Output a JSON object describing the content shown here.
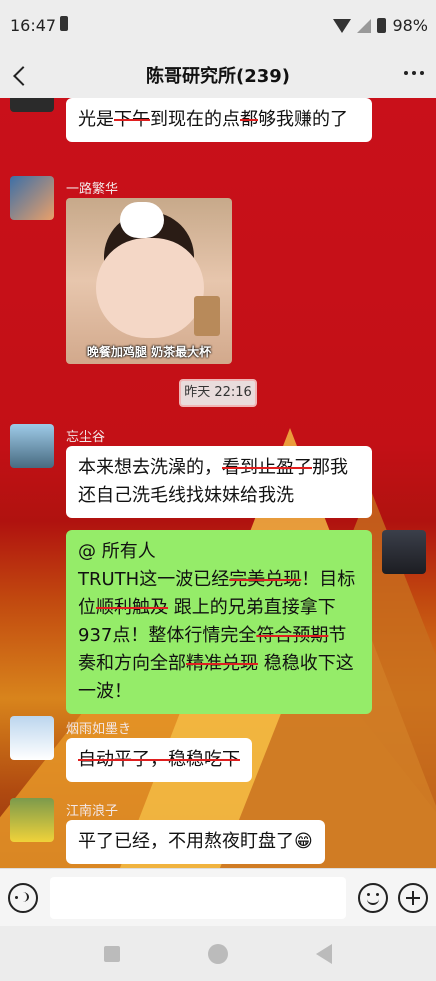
{
  "status_bar": {
    "time": "16:47",
    "battery": "98%"
  },
  "header": {
    "title": "陈哥研究所(239)"
  },
  "messages": {
    "m0": {
      "parts": [
        "光是",
        "下午",
        "到现在的点",
        "都",
        "够我赚的了"
      ]
    },
    "m1": {
      "sender": "一路繁华",
      "image_caption": "晚餐加鸡腿  奶茶最大杯"
    },
    "time_divider": "昨天 22:16",
    "m2": {
      "sender": "忘尘谷",
      "parts": [
        "本来想去洗澡的，",
        "看到止盈了",
        "那我还自己洗毛线找妹妹给我洗"
      ]
    },
    "m3": {
      "parts": [
        "@ 所有人",
        "TRUTH这一波已经",
        "完美兑现",
        "！目标位",
        "顺利触及",
        " 跟上的兄弟直接拿下937点！整体行情完全",
        "符合预期",
        "节奏和方向全部",
        "精准兑现",
        " 稳稳收下这一波！"
      ]
    },
    "m4": {
      "sender": "烟雨如墨き",
      "text": "自动平了，稳稳吃下"
    },
    "m5": {
      "sender": "江南浪子",
      "text": "平了已经，不用熬夜盯盘了😁"
    }
  },
  "colors": {
    "accent_green": "#95ec69",
    "chat_bg": "#c9101a",
    "strike": "#e02020"
  },
  "icons": [
    "back-icon",
    "more-icon",
    "voice-icon",
    "emoji-icon",
    "plus-icon"
  ]
}
